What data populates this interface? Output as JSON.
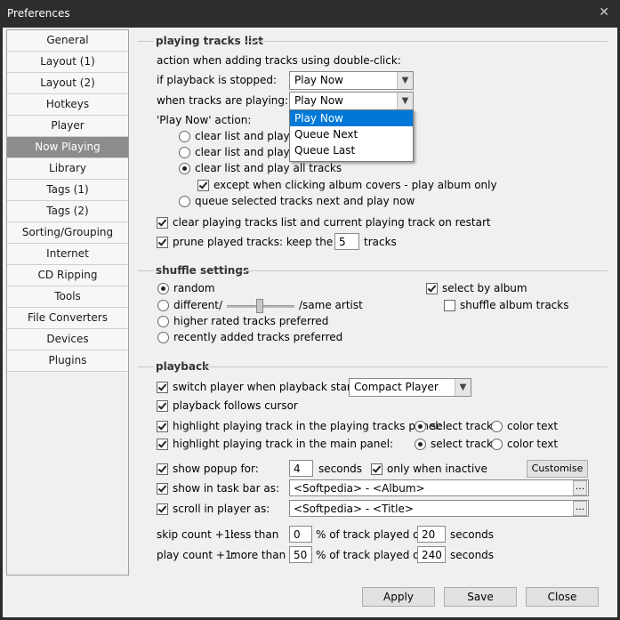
{
  "window": {
    "title": "Preferences"
  },
  "sidebar": {
    "items": [
      {
        "label": "General"
      },
      {
        "label": "Layout (1)"
      },
      {
        "label": "Layout (2)"
      },
      {
        "label": "Hotkeys"
      },
      {
        "label": "Player"
      },
      {
        "label": "Now Playing"
      },
      {
        "label": "Library"
      },
      {
        "label": "Tags (1)"
      },
      {
        "label": "Tags (2)"
      },
      {
        "label": "Sorting/Grouping"
      },
      {
        "label": "Internet"
      },
      {
        "label": "CD Ripping"
      },
      {
        "label": "Tools"
      },
      {
        "label": "File Converters"
      },
      {
        "label": "Devices"
      },
      {
        "label": "Plugins"
      }
    ],
    "active": "Now Playing"
  },
  "playing": {
    "title": "playing tracks list",
    "action_label": "action when adding tracks using double-click:",
    "stopped_label": "if playback is stopped:",
    "stopped_value": "Play Now",
    "playing_label": "when tracks are playing:",
    "playing_value": "Play Now",
    "dropdown_options": [
      "Play Now",
      "Queue Next",
      "Queue Last"
    ],
    "playnow_label": "'Play Now' action:",
    "opt1": "clear list and play se",
    "opt2": "clear list and play all",
    "opt3": "clear list and play all tracks",
    "opt3_sub": "except when clicking album covers - play album only",
    "opt4": "queue selected tracks next and play now",
    "clear_restart": "clear playing tracks list and current playing track on restart",
    "prune_label": "prune played tracks: keep the last",
    "prune_value": "5",
    "prune_suffix": "tracks"
  },
  "shuffle": {
    "title": "shuffle settings",
    "random": "random",
    "different": "different/",
    "same_artist": "/same artist",
    "higher_rated": "higher rated tracks preferred",
    "recently_added": "recently added tracks preferred",
    "select_album": "select by album",
    "shuffle_album": "shuffle album tracks"
  },
  "playback": {
    "title": "playback",
    "switch_label": "switch player when playback starts:",
    "switch_value": "Compact Player",
    "follows_cursor": "playback follows cursor",
    "highlight_panel": "highlight playing track in the playing tracks panel:",
    "highlight_main": "highlight playing track in the main panel:",
    "select_track": "select track",
    "color_text": "color text",
    "popup_label": "show popup for:",
    "popup_value": "4",
    "seconds": "seconds",
    "only_inactive": "only when inactive",
    "customise": "Customise",
    "taskbar_label": "show in task bar as:",
    "taskbar_value": "<Softpedia> - <Album>",
    "scroll_label": "scroll in player as:",
    "scroll_value": "<Softpedia> - <Title>",
    "dots": "...",
    "skip_label": "skip count +1:",
    "skip_less": "less than",
    "skip_value1": "0",
    "pct_label": "% of track played or",
    "skip_value2": "20",
    "play_label": "play count +1:",
    "play_more": "more than",
    "play_value1": "50",
    "play_value2": "240"
  },
  "buttons": {
    "apply": "Apply",
    "save": "Save",
    "close": "Close"
  },
  "icons": {
    "close": "✕",
    "arrow": "▼"
  }
}
